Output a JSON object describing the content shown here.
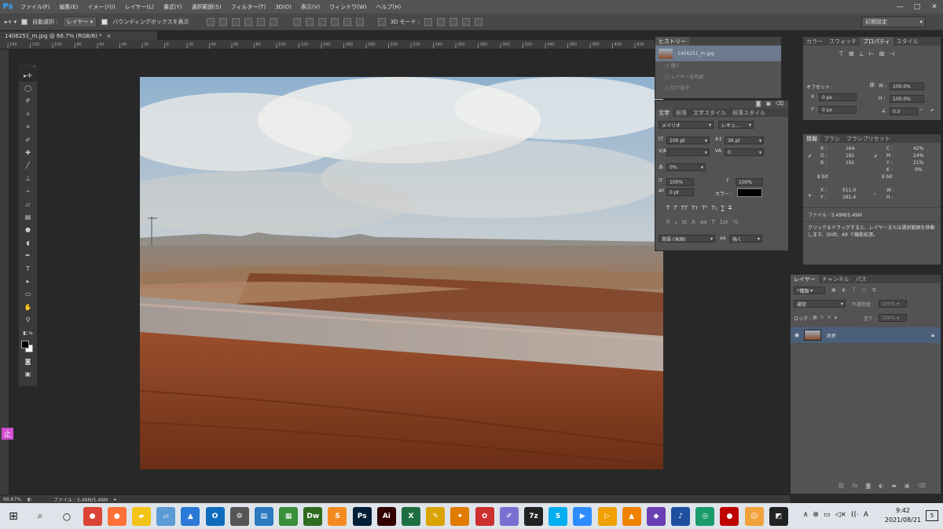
{
  "app": {
    "logo": "Ps"
  },
  "menu": [
    "ファイル(F)",
    "編集(E)",
    "イメージ(I)",
    "レイヤー(L)",
    "書式(Y)",
    "選択範囲(S)",
    "フィルター(T)",
    "3D(D)",
    "表示(V)",
    "ウィンドウ(W)",
    "ヘルプ(H)"
  ],
  "window_controls": [
    "—",
    "□",
    "✕"
  ],
  "options": {
    "auto_select_label": "自動選択 :",
    "auto_select_value": "レイヤー",
    "bounding_box_label": "バウンディングボックスを表示",
    "mode_3d_label": "3D モード :",
    "workspace": "初期設定"
  },
  "document": {
    "tab_title": "1406251_m.jpg @ 66.7% (RGB/8) *"
  },
  "ruler_ticks": [
    "140",
    "120",
    "100",
    "80",
    "60",
    "40",
    "20",
    "0",
    "20",
    "40",
    "60",
    "80",
    "100",
    "120",
    "140",
    "160",
    "180",
    "200",
    "220",
    "240",
    "260",
    "280",
    "300",
    "320",
    "340",
    "360",
    "380",
    "400",
    "420"
  ],
  "history": {
    "tab": "ヒストリー",
    "snapshot_name": "1406251_m.jpg",
    "items": [
      "開く",
      "レイヤーを作成",
      "切り抜き"
    ]
  },
  "character": {
    "tabs": [
      "文字",
      "段落",
      "文字スタイル",
      "段落スタイル"
    ],
    "font_family": "メイリオ",
    "font_style": "レギュ...",
    "font_size": "100 pt",
    "leading": "36 pt",
    "tracking": "0",
    "tsume": "0%",
    "vertical_scale": "100%",
    "horizontal_scale": "100%",
    "baseline": "0 pt",
    "color_label": "カラー :",
    "color": "#000000",
    "style_buttons": [
      "T",
      "T",
      "TT",
      "Tт",
      "T¹",
      "T₁",
      "T",
      "T"
    ],
    "language": "英語 (米国)",
    "aa_label": "aa",
    "antialias": "強く"
  },
  "properties": {
    "tabs": [
      "カラー",
      "スウォッチ",
      "プロパティ",
      "スタイル"
    ],
    "offset_label": "オフセット :",
    "x_label": "X :",
    "x_value": "0 px",
    "y_label": "Y :",
    "y_value": "0 px",
    "w_label": "W :",
    "w_value": "100.0%",
    "h_label": "H :",
    "h_value": "100.0%",
    "angle_value": "0.0",
    "angle_unit": "°"
  },
  "info": {
    "tabs": [
      "情報",
      "ブラシ",
      "ブラシプリセット"
    ],
    "r_label": "R :",
    "r": "164",
    "g_label": "G :",
    "g": "181",
    "b_label": "B :",
    "b": "191",
    "c_label": "C :",
    "c": "42%",
    "m_label": "M :",
    "m": "24%",
    "yc_label": "Y :",
    "yc": "21%",
    "k_label": "K :",
    "k": "0%",
    "bit1": "8 bit",
    "bit2": "8 bit",
    "x_label": "X :",
    "x": "511.0",
    "y_label": "Y :",
    "y": "161.4",
    "w_label": "W :",
    "h_label": "H :",
    "file": "ファイル : 5.49M/5.49M",
    "hint": "クリック＆ドラッグすると、レイヤーまたは選択範囲を移動します。Shift、Alt で機能拡張。"
  },
  "layers": {
    "tabs": [
      "レイヤー",
      "チャンネル",
      "パス"
    ],
    "filter": "種類",
    "blend": "通常",
    "opacity_label": "不透明度 :",
    "opacity": "100%",
    "lock_label": "ロック :",
    "fill_label": "塗り :",
    "fill": "100%",
    "layer_name": "背景"
  },
  "status": {
    "zoom": "66.67%",
    "file": "ファイル : 5.49M/5.49M"
  },
  "taskbar": {
    "apps": [
      {
        "name": "chrome",
        "color": "#db4437",
        "glyph": "●"
      },
      {
        "name": "firefox",
        "color": "#ff7139",
        "glyph": "●"
      },
      {
        "name": "explorer",
        "color": "#f3c317",
        "glyph": "▰"
      },
      {
        "name": "app-blue-1",
        "color": "#5b9bd5",
        "glyph": "▱"
      },
      {
        "name": "photos",
        "color": "#2b79d6",
        "glyph": "▲"
      },
      {
        "name": "outlook",
        "color": "#0f6cbd",
        "glyph": "O"
      },
      {
        "name": "settings",
        "color": "#555555",
        "glyph": "⚙"
      },
      {
        "name": "app-3",
        "color": "#2c7bbf",
        "glyph": "▤"
      },
      {
        "name": "app-4",
        "color": "#3a8f3a",
        "glyph": "▦"
      },
      {
        "name": "dreamweaver",
        "color": "#2e6b1f",
        "glyph": "Dw"
      },
      {
        "name": "app-5",
        "color": "#f48a1f",
        "glyph": "S"
      },
      {
        "name": "photoshop",
        "color": "#001e36",
        "glyph": "Ps"
      },
      {
        "name": "illustrator",
        "color": "#330000",
        "glyph": "Ai"
      },
      {
        "name": "excel",
        "color": "#1d6f42",
        "glyph": "X"
      },
      {
        "name": "app-6",
        "color": "#d9a400",
        "glyph": "✎"
      },
      {
        "name": "app-7",
        "color": "#e07b00",
        "glyph": "✦"
      },
      {
        "name": "app-8",
        "color": "#cc2f2f",
        "glyph": "✿"
      },
      {
        "name": "app-9",
        "color": "#7a6fd0",
        "glyph": "✐"
      },
      {
        "name": "7zip",
        "color": "#222222",
        "glyph": "7z"
      },
      {
        "name": "skype",
        "color": "#00aff0",
        "glyph": "S"
      },
      {
        "name": "zoom",
        "color": "#2d8cff",
        "glyph": "▶"
      },
      {
        "name": "app-10",
        "color": "#f0a000",
        "glyph": "▷"
      },
      {
        "name": "vlc",
        "color": "#f08000",
        "glyph": "▲"
      },
      {
        "name": "app-11",
        "color": "#6b3fb3",
        "glyph": "◆"
      },
      {
        "name": "app-12",
        "color": "#1f4f9f",
        "glyph": "♪"
      },
      {
        "name": "app-13",
        "color": "#1a9b6a",
        "glyph": "◎"
      },
      {
        "name": "app-14",
        "color": "#c00000",
        "glyph": "●"
      },
      {
        "name": "app-15",
        "color": "#f2a23a",
        "glyph": "☺"
      },
      {
        "name": "app-16",
        "color": "#222222",
        "glyph": "◩"
      }
    ],
    "time": "9:42",
    "date": "2021/08/21",
    "notif": "5",
    "ime": "A",
    "tray": [
      "∧",
      "⊕",
      "▭",
      "◁×",
      "((·",
      "A"
    ]
  },
  "side_badge": "止"
}
